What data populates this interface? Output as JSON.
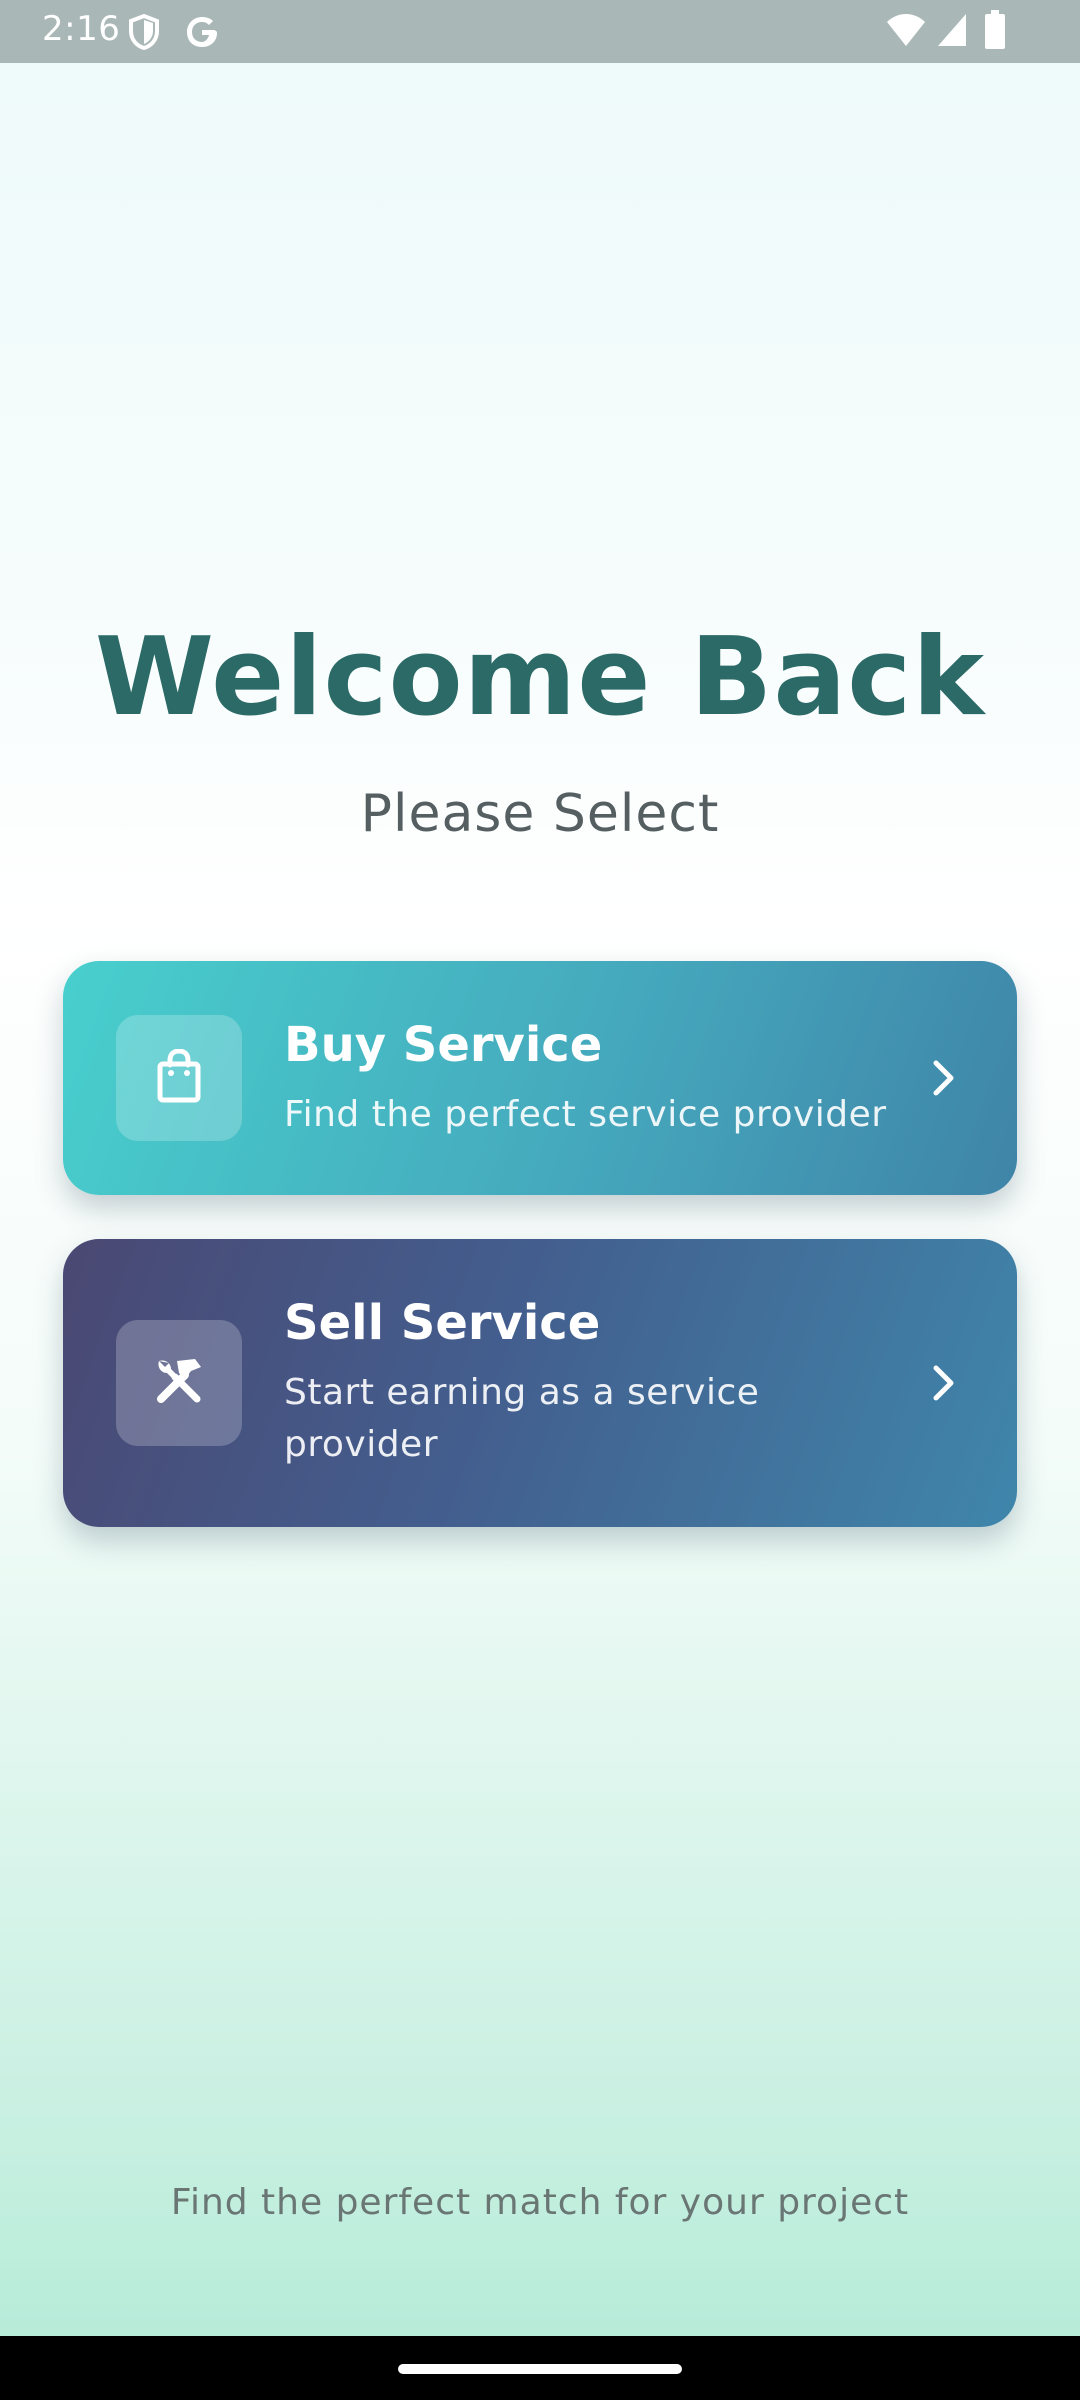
{
  "status_bar": {
    "time": "2:16",
    "icons": [
      "shield-icon",
      "google-g-icon",
      "wifi-icon",
      "signal-icon",
      "battery-icon"
    ]
  },
  "header": {
    "title": "Welcome Back",
    "subtitle": "Please Select"
  },
  "options": [
    {
      "title": "Buy Service",
      "description": "Find the perfect service provider",
      "icon": "shopping-bag-icon",
      "gradient": [
        "#48cfcd",
        "#3f84a8"
      ]
    },
    {
      "title": "Sell Service",
      "description": "Start earning as a service provider",
      "icon": "tools-icon",
      "gradient": [
        "#4a4873",
        "#3f86ab"
      ]
    }
  ],
  "footer": {
    "text": "Find the perfect match for your project"
  },
  "colors": {
    "title": "#2b6a66",
    "status_bar": "#aab7b7"
  }
}
